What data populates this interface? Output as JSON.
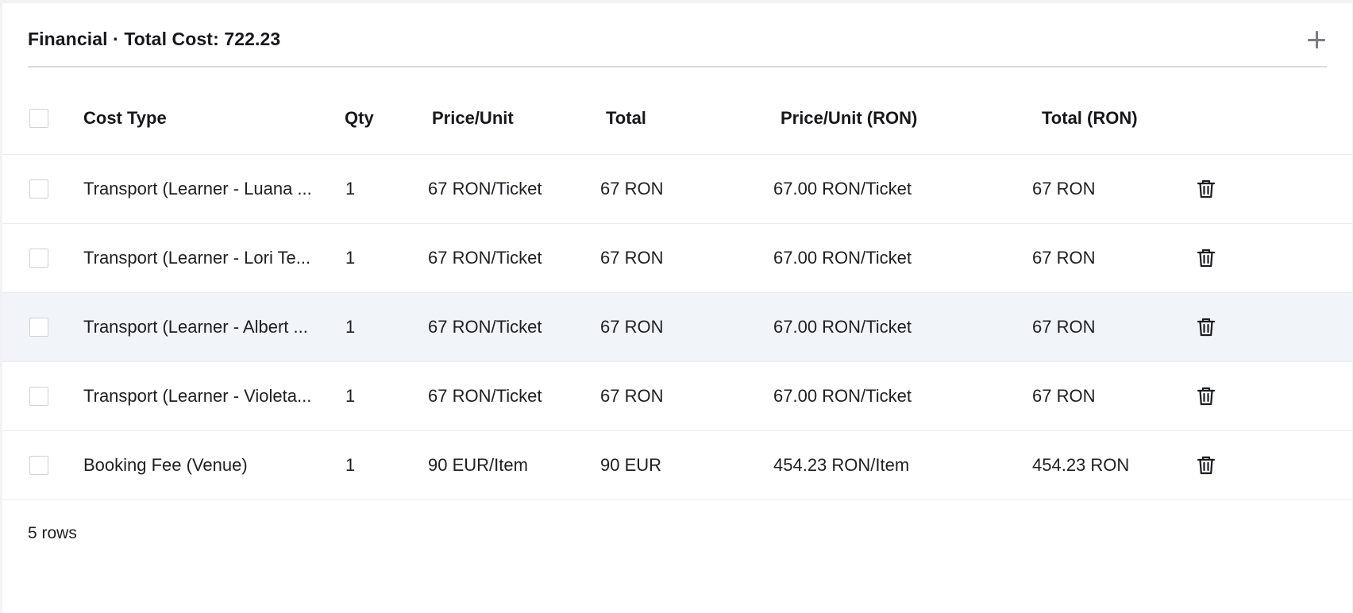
{
  "panel": {
    "title": "Financial · Total Cost: 722.23",
    "add_icon": "plus-icon"
  },
  "table": {
    "columns": [
      "Cost Type",
      "Qty",
      "Price/Unit",
      "Total",
      "Price/Unit (RON)",
      "Total (RON)"
    ],
    "rows": [
      {
        "cost_type": "Transport (Learner - Luana ...",
        "qty": "1",
        "price_unit": "67 RON/Ticket",
        "total": "67 RON",
        "price_unit_ron": "67.00 RON/Ticket",
        "total_ron": "67 RON"
      },
      {
        "cost_type": "Transport (Learner - Lori Te...",
        "qty": "1",
        "price_unit": "67 RON/Ticket",
        "total": "67 RON",
        "price_unit_ron": "67.00 RON/Ticket",
        "total_ron": "67 RON"
      },
      {
        "cost_type": "Transport (Learner - Albert ...",
        "qty": "1",
        "price_unit": "67 RON/Ticket",
        "total": "67 RON",
        "price_unit_ron": "67.00 RON/Ticket",
        "total_ron": "67 RON"
      },
      {
        "cost_type": "Transport (Learner - Violeta...",
        "qty": "1",
        "price_unit": "67 RON/Ticket",
        "total": "67 RON",
        "price_unit_ron": "67.00 RON/Ticket",
        "total_ron": "67 RON"
      },
      {
        "cost_type": "Booking Fee (Venue)",
        "qty": "1",
        "price_unit": "90 EUR/Item",
        "total": "90 EUR",
        "price_unit_ron": "454.23 RON/Item",
        "total_ron": "454.23 RON"
      }
    ],
    "hovered_row_index": 2,
    "row_action_icon": "trash-icon"
  },
  "footer": {
    "row_count": "5 rows"
  },
  "colors": {
    "hover_row": "#f1f4f8",
    "divider": "#d9dadd",
    "text": "#1d1f23",
    "icon": "#1b1d21"
  }
}
